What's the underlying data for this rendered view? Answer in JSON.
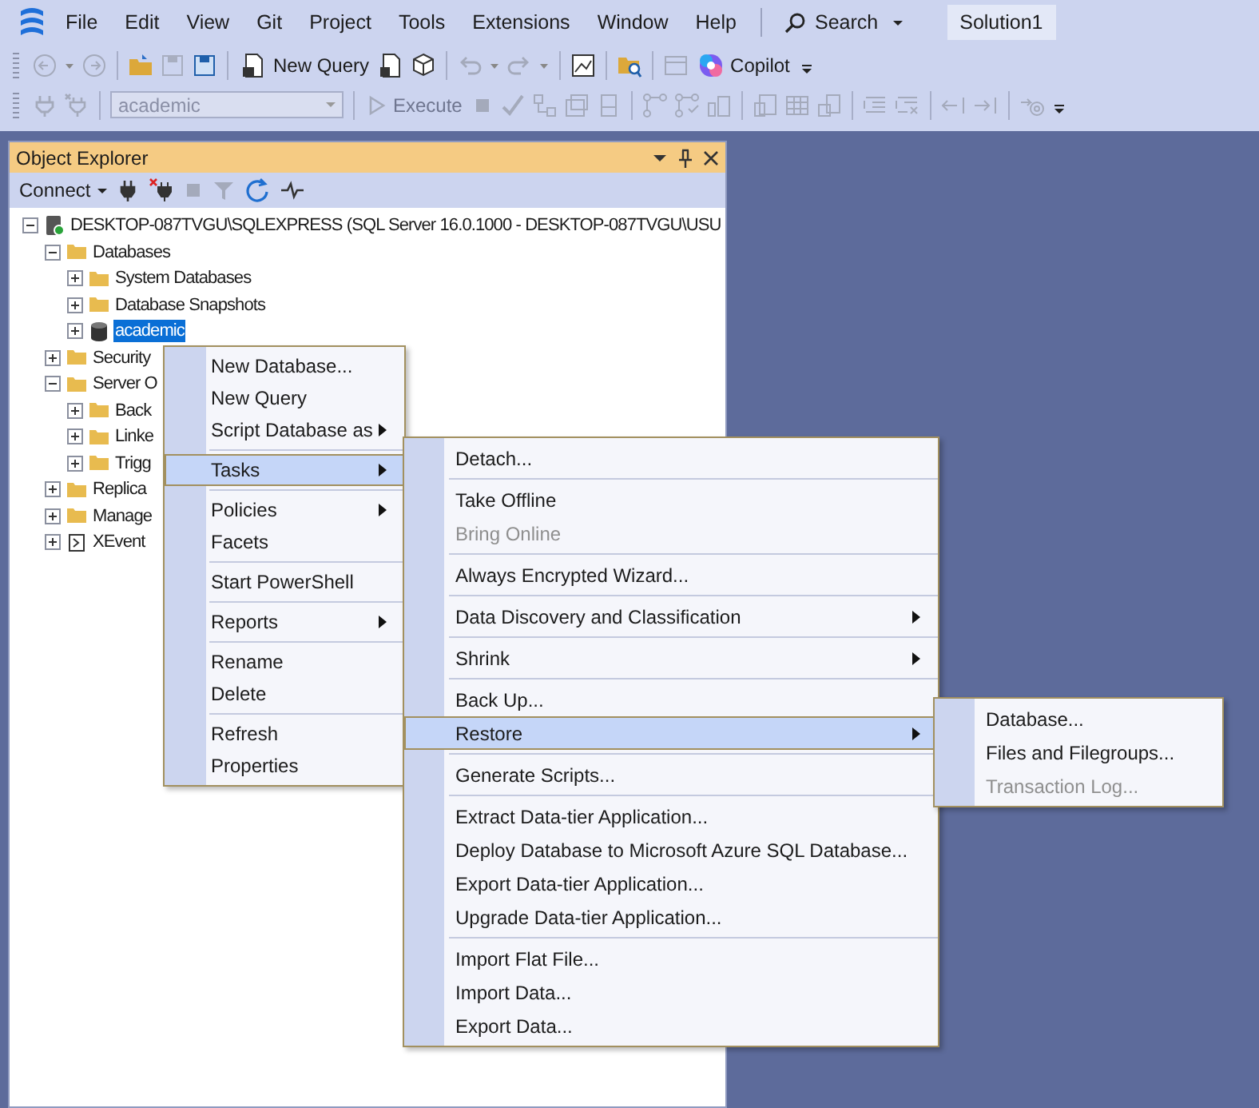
{
  "menu_bar": {
    "items": [
      "File",
      "Edit",
      "View",
      "Git",
      "Project",
      "Tools",
      "Extensions",
      "Window",
      "Help"
    ],
    "search": "Search",
    "solution": "Solution1"
  },
  "toolbar_1": {
    "new_query": "New Query",
    "copilot": "Copilot"
  },
  "toolbar_2": {
    "database": "academic",
    "execute": "Execute"
  },
  "object_explorer": {
    "title": "Object Explorer",
    "connect": "Connect",
    "tree": [
      {
        "label": "DESKTOP-087TVGU\\SQLEXPRESS (SQL Server 16.0.1000 - DESKTOP-087TVGU\\USU",
        "kind": "server",
        "expanded": true,
        "selected": false,
        "children": [
          {
            "label": "Databases",
            "kind": "folder",
            "expanded": true,
            "selected": false,
            "children": [
              {
                "label": "System Databases",
                "kind": "folder",
                "expanded": false,
                "selected": false
              },
              {
                "label": "Database Snapshots",
                "kind": "folder",
                "expanded": false,
                "selected": false
              },
              {
                "label": "academic",
                "kind": "database",
                "expanded": false,
                "selected": true
              }
            ]
          },
          {
            "label": "Security",
            "kind": "folder",
            "expanded": false,
            "selected": false
          },
          {
            "label": "Server O",
            "kind": "folder",
            "expanded": true,
            "selected": false,
            "children": [
              {
                "label": "Back",
                "kind": "folder",
                "expanded": false,
                "selected": false
              },
              {
                "label": "Linke",
                "kind": "folder",
                "expanded": false,
                "selected": false
              },
              {
                "label": "Trigg",
                "kind": "folder",
                "expanded": false,
                "selected": false
              }
            ]
          },
          {
            "label": "Replica",
            "kind": "folder",
            "expanded": false,
            "selected": false
          },
          {
            "label": "Manage",
            "kind": "folder",
            "expanded": false,
            "selected": false
          },
          {
            "label": "XEvent",
            "kind": "xevent",
            "expanded": false,
            "selected": false
          }
        ]
      }
    ]
  },
  "context_menu": {
    "groups": [
      [
        {
          "label": "New Database...",
          "submenu": false,
          "selected": false,
          "disabled": false
        },
        {
          "label": "New Query",
          "submenu": false,
          "selected": false,
          "disabled": false
        },
        {
          "label": "Script Database as",
          "submenu": true,
          "selected": false,
          "disabled": false
        }
      ],
      [
        {
          "label": "Tasks",
          "submenu": true,
          "selected": true,
          "disabled": false
        }
      ],
      [
        {
          "label": "Policies",
          "submenu": true,
          "selected": false,
          "disabled": false
        },
        {
          "label": "Facets",
          "submenu": false,
          "selected": false,
          "disabled": false
        }
      ],
      [
        {
          "label": "Start PowerShell",
          "submenu": false,
          "selected": false,
          "disabled": false
        }
      ],
      [
        {
          "label": "Reports",
          "submenu": true,
          "selected": false,
          "disabled": false
        }
      ],
      [
        {
          "label": "Rename",
          "submenu": false,
          "selected": false,
          "disabled": false
        },
        {
          "label": "Delete",
          "submenu": false,
          "selected": false,
          "disabled": false
        }
      ],
      [
        {
          "label": "Refresh",
          "submenu": false,
          "selected": false,
          "disabled": false
        },
        {
          "label": "Properties",
          "submenu": false,
          "selected": false,
          "disabled": false
        }
      ]
    ]
  },
  "tasks_submenu": {
    "groups": [
      [
        {
          "label": "Detach...",
          "submenu": false,
          "selected": false,
          "disabled": false
        }
      ],
      [
        {
          "label": "Take Offline",
          "submenu": false,
          "selected": false,
          "disabled": false
        },
        {
          "label": "Bring Online",
          "submenu": false,
          "selected": false,
          "disabled": true
        }
      ],
      [
        {
          "label": "Always Encrypted Wizard...",
          "submenu": false,
          "selected": false,
          "disabled": false
        }
      ],
      [
        {
          "label": "Data Discovery and Classification",
          "submenu": true,
          "selected": false,
          "disabled": false
        }
      ],
      [
        {
          "label": "Shrink",
          "submenu": true,
          "selected": false,
          "disabled": false
        }
      ],
      [
        {
          "label": "Back Up...",
          "submenu": false,
          "selected": false,
          "disabled": false
        },
        {
          "label": "Restore",
          "submenu": true,
          "selected": true,
          "disabled": false
        }
      ],
      [
        {
          "label": "Generate Scripts...",
          "submenu": false,
          "selected": false,
          "disabled": false
        }
      ],
      [
        {
          "label": "Extract Data-tier Application...",
          "submenu": false,
          "selected": false,
          "disabled": false
        },
        {
          "label": "Deploy Database to Microsoft Azure SQL Database...",
          "submenu": false,
          "selected": false,
          "disabled": false
        },
        {
          "label": "Export Data-tier Application...",
          "submenu": false,
          "selected": false,
          "disabled": false
        },
        {
          "label": "Upgrade Data-tier Application...",
          "submenu": false,
          "selected": false,
          "disabled": false
        }
      ],
      [
        {
          "label": "Import Flat File...",
          "submenu": false,
          "selected": false,
          "disabled": false
        },
        {
          "label": "Import Data...",
          "submenu": false,
          "selected": false,
          "disabled": false
        },
        {
          "label": "Export Data...",
          "submenu": false,
          "selected": false,
          "disabled": false
        }
      ]
    ]
  },
  "restore_submenu": {
    "groups": [
      [
        {
          "label": "Database...",
          "submenu": false,
          "selected": false,
          "disabled": false
        },
        {
          "label": "Files and Filegroups...",
          "submenu": false,
          "selected": false,
          "disabled": false
        },
        {
          "label": "Transaction Log...",
          "submenu": false,
          "selected": false,
          "disabled": true
        }
      ]
    ]
  }
}
